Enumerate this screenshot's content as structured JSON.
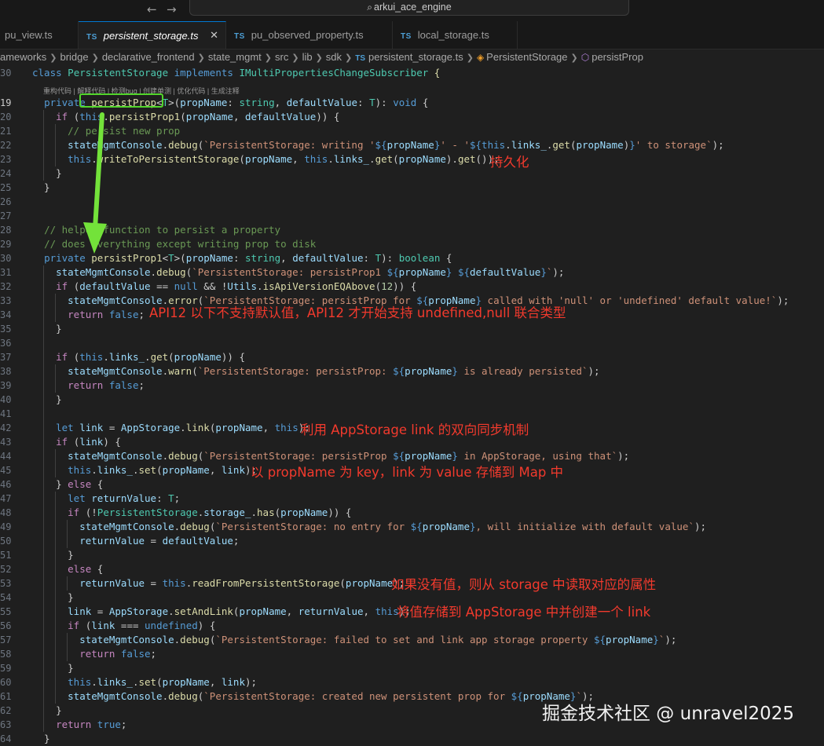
{
  "window": {
    "search_label": "arkui_ace_engine",
    "back_icon": "←",
    "forward_icon": "→"
  },
  "tabs": [
    {
      "label": "pu_view.ts",
      "badge": ""
    },
    {
      "label": "persistent_storage.ts",
      "badge": "TS"
    },
    {
      "label": "pu_observed_property.ts",
      "badge": "TS"
    },
    {
      "label": "local_storage.ts",
      "badge": "TS"
    }
  ],
  "breadcrumb": [
    "ameworks",
    "bridge",
    "declarative_frontend",
    "state_mgmt",
    "src",
    "lib",
    "sdk",
    "persistent_storage.ts",
    "PersistentStorage",
    "persistProp"
  ],
  "codelens": "重构代码 | 解释代码 | 检测bug | 创建单测 | 优化代码 | 生成注释",
  "code": {
    "ln_header": "30",
    "ln_19": "19",
    "ln_20": "20",
    "ln_21": "21",
    "ln_22": "22",
    "ln_23": "23",
    "ln_24": "24",
    "ln_25": "25",
    "ln_26": "26",
    "ln_27": "27",
    "ln_28": "28",
    "ln_29": "29",
    "ln_30": "30",
    "ln_31": "31",
    "ln_32": "32",
    "ln_33": "33",
    "ln_34": "34",
    "ln_35": "35",
    "ln_36": "36",
    "ln_37": "37",
    "ln_38": "38",
    "ln_39": "39",
    "ln_40": "40",
    "ln_41": "41",
    "ln_42": "42",
    "ln_43": "43",
    "ln_44": "44",
    "ln_45": "45",
    "ln_46": "46",
    "ln_47": "47",
    "ln_48": "48",
    "ln_49": "49",
    "ln_50": "50",
    "ln_51": "51",
    "ln_52": "52",
    "ln_53": "53",
    "ln_54": "54",
    "ln_55": "55",
    "ln_56": "56",
    "ln_57": "57",
    "ln_58": "58",
    "ln_59": "59",
    "ln_60": "60",
    "ln_61": "61",
    "ln_62": "62",
    "ln_63": "63",
    "ln_64": "64"
  },
  "annotations": {
    "a1": "持久化",
    "a2": "API12 以下不支持默认值，API12 才开始支持 undefined,null 联合类型",
    "a3": "利用 AppStorage  link 的双向同步机制",
    "a4": "以 propName 为 key，link 为 value 存储到 Map 中",
    "a5": "如果没有值，则从 storage 中读取对应的属性",
    "a6": "将值存储到 AppStorage 中并创建一个 link"
  },
  "watermark": "掘金技术社区 @ unravel2025",
  "colors": {
    "annotation": "#f23a2d",
    "highlight_box": "#52d62b",
    "arrow": "#73e23a"
  }
}
